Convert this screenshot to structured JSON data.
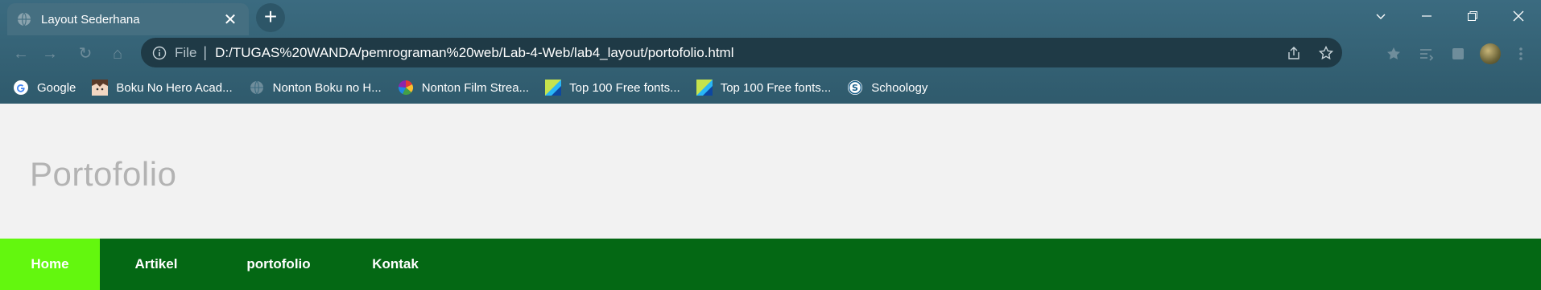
{
  "browser": {
    "tab_title": "Layout Sederhana",
    "address": {
      "scheme_label": "File",
      "url": "D:/TUGAS%20WANDA/pemrograman%20web/Lab-4-Web/lab4_layout/portofolio.html"
    },
    "bookmarks": [
      {
        "label": "Google",
        "icon": "google-icon"
      },
      {
        "label": "Boku No Hero Acad...",
        "icon": "anime-avatar-icon"
      },
      {
        "label": "Nonton Boku no H...",
        "icon": "globe-icon"
      },
      {
        "label": "Nonton Film Strea...",
        "icon": "pinwheel-icon"
      },
      {
        "label": "Top 100 Free fonts...",
        "icon": "fonts-site-icon"
      },
      {
        "label": "Top 100 Free fonts...",
        "icon": "fonts-site-icon"
      },
      {
        "label": "Schoology",
        "icon": "schoology-icon"
      }
    ]
  },
  "page": {
    "title": "Portofolio",
    "nav": [
      {
        "label": "Home",
        "active": true
      },
      {
        "label": "Artikel",
        "active": false
      },
      {
        "label": "portofolio",
        "active": false
      },
      {
        "label": "Kontak",
        "active": false
      }
    ]
  },
  "colors": {
    "chrome": "#34606f",
    "omnibox": "#1f3a46",
    "header_bg": "#f2f2f2",
    "title_text": "#b3b3b3",
    "nav_bg": "#046814",
    "nav_active": "#63f70e"
  }
}
